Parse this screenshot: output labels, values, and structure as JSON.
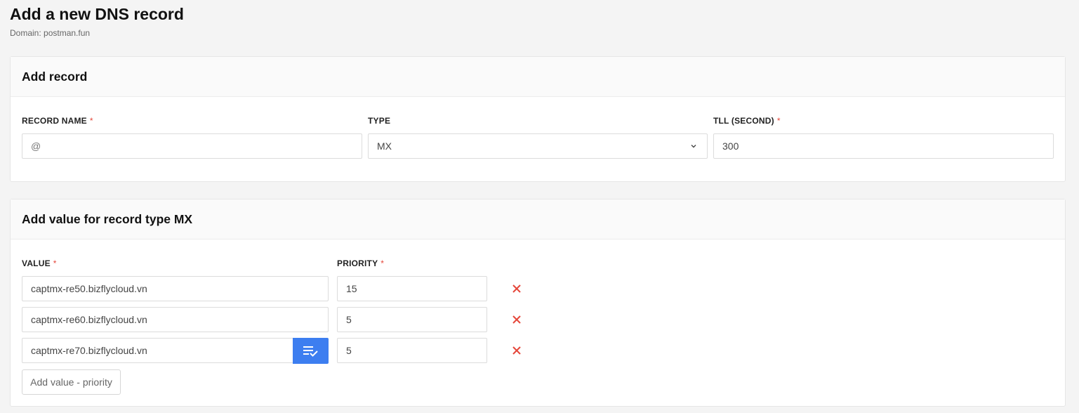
{
  "page": {
    "title": "Add a new DNS record",
    "subtitle": "Domain: postman.fun"
  },
  "record_card": {
    "title": "Add record",
    "record_name": {
      "label": "RECORD NAME",
      "required_mark": "*",
      "value": "@"
    },
    "type": {
      "label": "TYPE",
      "selected": "MX"
    },
    "ttl": {
      "label": "TLL (SECOND)",
      "required_mark": "*",
      "value": "300"
    }
  },
  "values_card": {
    "title": "Add value for record type MX",
    "value_label": "VALUE",
    "priority_label": "PRIORITY",
    "required_mark": "*",
    "rows": [
      {
        "value": "captmx-re50.bizflycloud.vn",
        "priority": "15"
      },
      {
        "value": "captmx-re60.bizflycloud.vn",
        "priority": "5"
      },
      {
        "value": "captmx-re70.bizflycloud.vn",
        "priority": "5"
      }
    ],
    "add_button_label": "Add value - priority"
  },
  "colors": {
    "accent": "#3d7ef0",
    "danger": "#e5473b",
    "background": "#f4f4f4"
  },
  "icons": {
    "select_arrow": "chevron-down-icon",
    "apply": "playlist-check-icon",
    "remove": "close-icon"
  }
}
